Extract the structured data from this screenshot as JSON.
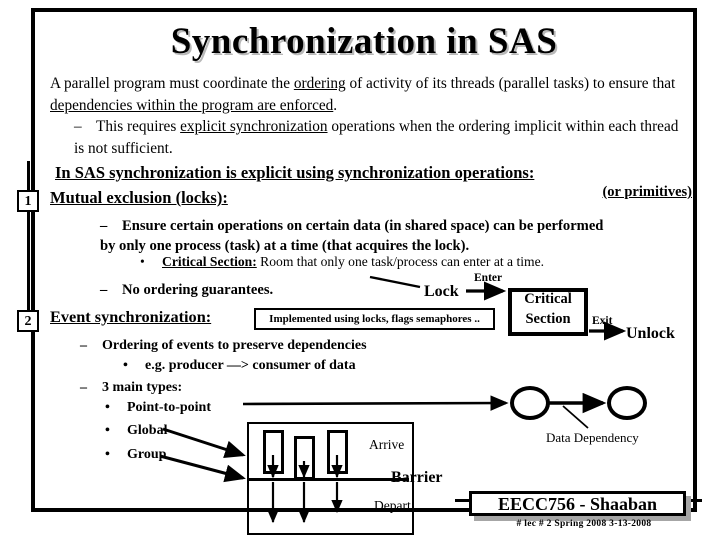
{
  "slide": {
    "title": "Synchronization in SAS",
    "paragraph": {
      "line1_a": "A parallel program must coordinate the ",
      "line1_u": "ordering",
      "line1_b": " of activity of its threads (parallel tasks) to ensure that ",
      "line1_u2": "dependencies within the program are enforced",
      "line1_c": ".",
      "sub_a": "This requires ",
      "sub_u": "explicit synchronization",
      "sub_b": " operations when the ordering implicit within each thread is not sufficient."
    },
    "heading_sas": "In SAS synchronization is explicit using synchronization operations:",
    "or_primitives": "(or primitives)",
    "section1": {
      "marker": "1",
      "heading": "Mutual exclusion (locks):",
      "bullet1": "Ensure certain operations on certain data (in shared space) can be performed by only one process (task) at a time (that acquires the lock).",
      "subbullet_label": "Critical Section:",
      "subbullet_text": " Room that only one task/process can enter at a time.",
      "bullet2": "No ordering guarantees."
    },
    "section2": {
      "marker": "2",
      "heading": "Event synchronization:",
      "note": "Implemented using locks, flags semaphores ..",
      "bullet1": "Ordering of events to preserve dependencies",
      "subbullet1": "e.g.    producer —> consumer of data",
      "bullet2": "3 main types:",
      "type1": "Point-to-point",
      "type2": "Global",
      "type3": "Group"
    },
    "lock_diagram": {
      "lock": "Lock",
      "enter": "Enter",
      "critical_line1": "Critical",
      "critical_line2": "Section",
      "exit": "Exit",
      "unlock": "Unlock"
    },
    "barrier_diagram": {
      "arrive": "Arrive",
      "barrier": "Barrier",
      "depart": "Depart"
    },
    "dependency_diagram": {
      "label": "Data Dependency"
    },
    "footer": {
      "course": "EECC756 - Shaaban",
      "details": "#  lec # 2    Spring 2008   3-13-2008"
    }
  }
}
